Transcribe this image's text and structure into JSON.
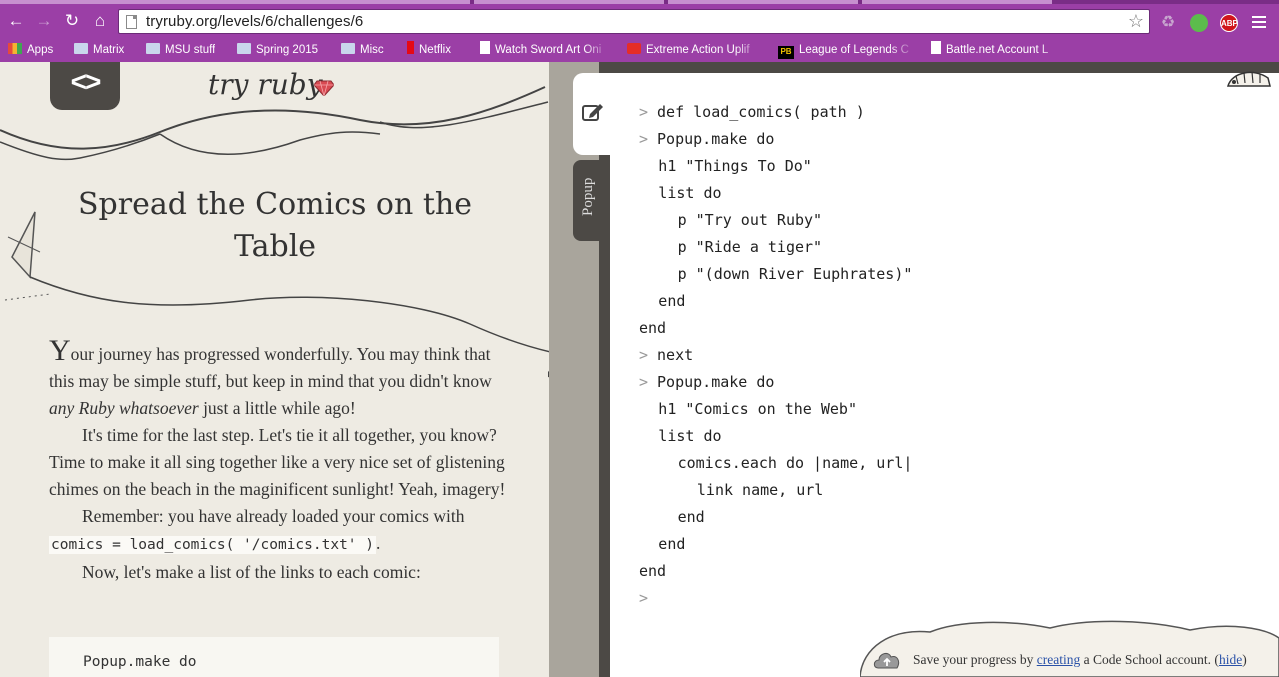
{
  "browser": {
    "url": "tryruby.org/levels/6/challenges/6",
    "bookmarks": [
      {
        "label": "Apps",
        "icon": "apps-grid-icon"
      },
      {
        "label": "Matrix",
        "icon": "folder-icon"
      },
      {
        "label": "MSU stuff",
        "icon": "folder-icon"
      },
      {
        "label": "Spring 2015",
        "icon": "folder-icon"
      },
      {
        "label": "Misc",
        "icon": "folder-icon"
      },
      {
        "label": "Netflix",
        "icon": "netflix-icon"
      },
      {
        "label": "Watch Sword Art Oni",
        "icon": "page-icon"
      },
      {
        "label": "Extreme Action Uplif",
        "icon": "youtube-icon"
      },
      {
        "label": "League of Legends C",
        "icon": "pb-icon"
      },
      {
        "label": "Battle.net Account L",
        "icon": "page-icon"
      }
    ],
    "extensions": [
      "recycle-icon",
      "evernote-icon",
      "adblock-icon",
      "menu-icon"
    ],
    "abp_label": "ABP"
  },
  "lesson": {
    "logo": "try ruby",
    "title": "Spread the Comics on the Table",
    "p1_first": "Y",
    "p1_a": "our journey has progressed wonderfully. You may think that this may be simple stuff, but keep in mind that you didn't know ",
    "p1_em": "any Ruby whatsoever",
    "p1_b": " just a little while ago!",
    "p2": "It's time for the last step. Let's tie it all together, you know? Time to make it all sing together like a very nice set of glistening chimes on the beach in the maginificent sunlight! Yeah, imagery!",
    "p3_a": "Remember: you have already loaded your comics with ",
    "p3_code": "comics = load_comics( '/comics.txt' )",
    "p3_b": ".",
    "p4": "Now, let's make a list of the links to each comic:",
    "code_example": "Popup.make do"
  },
  "console": {
    "popup_tab_label": "Popup",
    "lines": [
      {
        "prompt": ">",
        "text": "def load_comics( path )"
      },
      {
        "prompt": ">",
        "text": "Popup.make do"
      },
      {
        "prompt": "",
        "text": "h1 \"Things To Do\"",
        "indent": 1
      },
      {
        "prompt": "",
        "text": "list do",
        "indent": 1
      },
      {
        "prompt": "",
        "text": "p \"Try out Ruby\"",
        "indent": 2
      },
      {
        "prompt": "",
        "text": "p \"Ride a tiger\"",
        "indent": 2
      },
      {
        "prompt": "",
        "text": "p \"(down River Euphrates)\"",
        "indent": 2
      },
      {
        "prompt": "",
        "text": "end",
        "indent": 1
      },
      {
        "prompt": "",
        "text": "end",
        "indent": 0
      },
      {
        "prompt": ">",
        "text": "next"
      },
      {
        "prompt": ">",
        "text": "Popup.make do"
      },
      {
        "prompt": "",
        "text": "h1 \"Comics on the Web\"",
        "indent": 1
      },
      {
        "prompt": "",
        "text": "list do",
        "indent": 1
      },
      {
        "prompt": "",
        "text": "comics.each do |name, url|",
        "indent": 2
      },
      {
        "prompt": "",
        "text": "link name, url",
        "indent": 3
      },
      {
        "prompt": "",
        "text": "end",
        "indent": 2
      },
      {
        "prompt": "",
        "text": "end",
        "indent": 1
      },
      {
        "prompt": "",
        "text": "end",
        "indent": 0
      },
      {
        "prompt": ">",
        "text": ""
      }
    ]
  },
  "save_banner": {
    "text_a": "Save your progress by ",
    "link_creating": "creating",
    "text_b": " a Code School account. (",
    "link_hide": "hide",
    "text_c": ")"
  }
}
